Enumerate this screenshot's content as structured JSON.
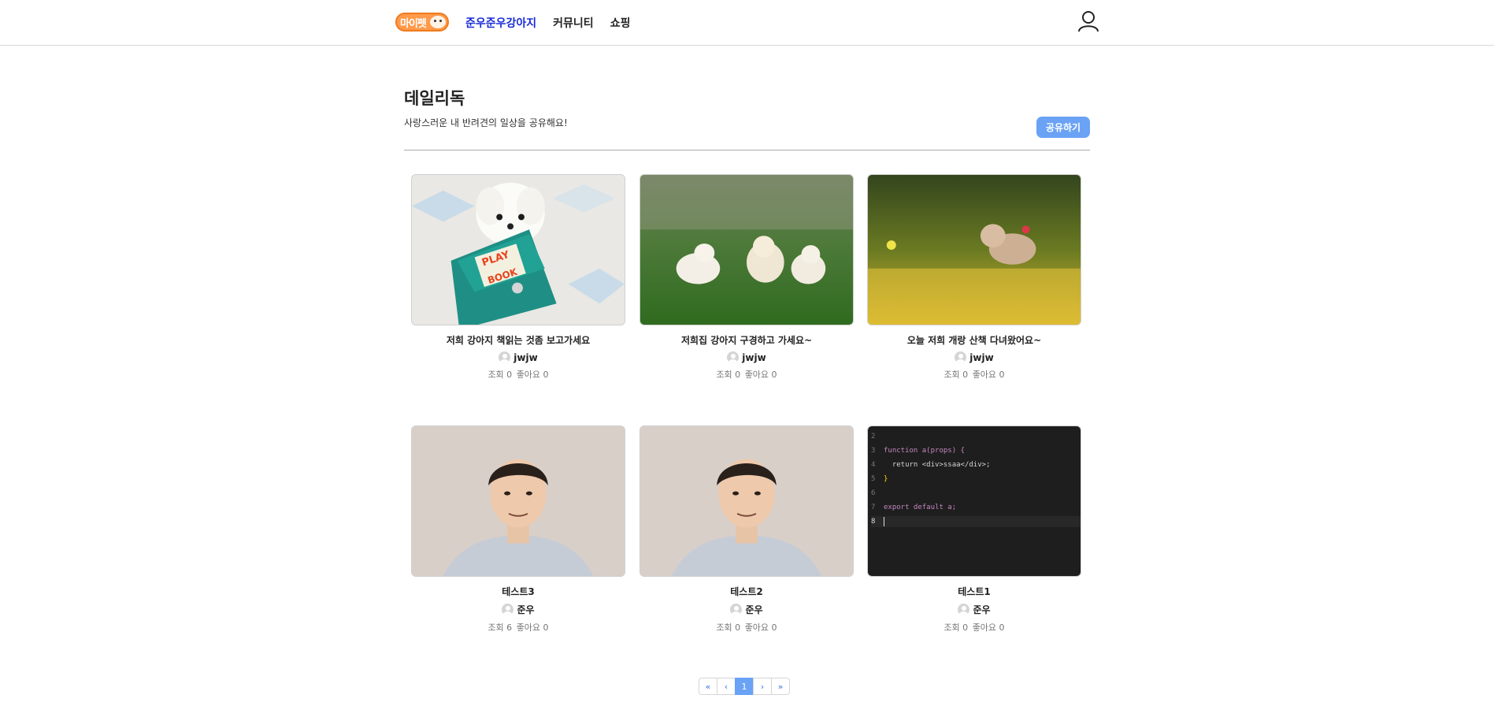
{
  "header": {
    "logo_text": "마이펫",
    "nav": [
      {
        "label": "준우준우강아지",
        "active": true
      },
      {
        "label": "커뮤니티",
        "active": false
      },
      {
        "label": "쇼핑",
        "active": false
      }
    ],
    "user_icon": "user-icon"
  },
  "page": {
    "title": "데일리독",
    "subtitle": "사랑스러운 내 반려견의 일상을 공유해요!",
    "share_label": "공유하기"
  },
  "posts": [
    {
      "title": "저희 강아지 책읽는 것좀 보고가세요",
      "author": "jwjw",
      "views_label": "조회 0",
      "likes_label": "좋아요 0",
      "image": "white-puppy-with-book"
    },
    {
      "title": "저희집 강아지 구경하고 가세요~",
      "author": "jwjw",
      "views_label": "조회 0",
      "likes_label": "좋아요 0",
      "image": "three-puppies-on-grass"
    },
    {
      "title": "오늘 저희 개랑 산책 다녀왔어요~",
      "author": "jwjw",
      "views_label": "조회 0",
      "likes_label": "좋아요 0",
      "image": "puppy-running-in-flowers"
    },
    {
      "title": "테스트3",
      "author": "준우",
      "views_label": "조회 6",
      "likes_label": "좋아요 0",
      "image": "man-portrait"
    },
    {
      "title": "테스트2",
      "author": "준우",
      "views_label": "조회 0",
      "likes_label": "좋아요 0",
      "image": "man-portrait"
    },
    {
      "title": "테스트1",
      "author": "준우",
      "views_label": "조회 0",
      "likes_label": "좋아요 0",
      "image": "code-editor-screenshot"
    }
  ],
  "code_snippet": {
    "lines": [
      {
        "n": "2",
        "text": ""
      },
      {
        "n": "3",
        "text": "function a(props) {"
      },
      {
        "n": "4",
        "text": "  return <div>ssaa</div>;"
      },
      {
        "n": "5",
        "text": "}"
      },
      {
        "n": "6",
        "text": ""
      },
      {
        "n": "7",
        "text": "export default a;"
      },
      {
        "n": "8",
        "text": ""
      }
    ]
  },
  "pagination": {
    "first": "«",
    "prev": "‹",
    "current": "1",
    "next": "›",
    "last": "»"
  },
  "colors": {
    "accent": "#6aa2f5",
    "nav_active": "#1a2bd6",
    "logo": "#ff9a4a"
  }
}
